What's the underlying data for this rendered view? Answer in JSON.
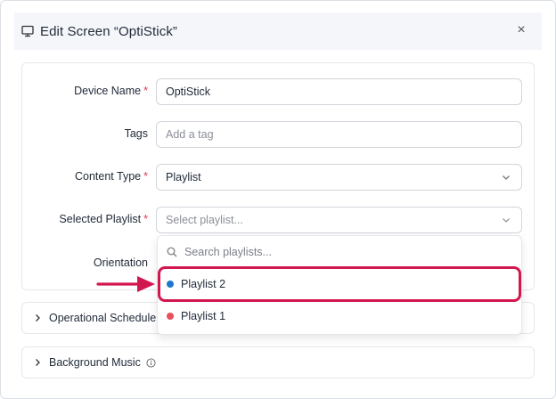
{
  "header": {
    "title": "Edit Screen “OptiStick”",
    "close_glyph": "×"
  },
  "form": {
    "device_name": {
      "label": "Device Name",
      "value": "OptiStick",
      "required": "*"
    },
    "tags": {
      "label": "Tags",
      "placeholder": "Add a tag"
    },
    "content_type": {
      "label": "Content Type",
      "value": "Playlist",
      "required": "*"
    },
    "selected_playlist": {
      "label": "Selected Playlist",
      "placeholder": "Select playlist...",
      "required": "*"
    },
    "orientation": {
      "label": "Orientation"
    }
  },
  "dropdown": {
    "search_placeholder": "Search playlists...",
    "options": [
      {
        "label": "Playlist 2",
        "color": "#1f77c9"
      },
      {
        "label": "Playlist 1",
        "color": "#e8505b"
      }
    ]
  },
  "sections": [
    {
      "label": "Operational Schedule"
    },
    {
      "label": "Background Music"
    }
  ],
  "colors": {
    "highlight": "#d2174f",
    "required": "#e0364f"
  }
}
